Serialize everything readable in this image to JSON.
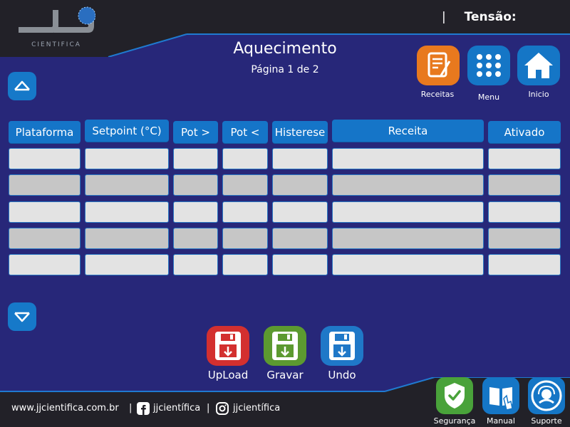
{
  "header": {
    "brand_text": "CIENTIFICA",
    "tensao_label": "Tensão:",
    "separator": "|"
  },
  "page": {
    "title": "Aquecimento",
    "subtitle": "Página 1 de 2"
  },
  "nav_tiles": {
    "receitas": "Receitas",
    "menu": "Menu",
    "inicio": "Inicio"
  },
  "table": {
    "columns": [
      "Plataforma",
      "Setpoint (°C)",
      "Pot >",
      "Pot <",
      "Histerese",
      "Receita",
      "Ativado"
    ],
    "rows": [
      [
        "",
        "",
        "",
        "",
        "",
        "",
        ""
      ],
      [
        "",
        "",
        "",
        "",
        "",
        "",
        ""
      ],
      [
        "",
        "",
        "",
        "",
        "",
        "",
        ""
      ],
      [
        "",
        "",
        "",
        "",
        "",
        "",
        ""
      ],
      [
        "",
        "",
        "",
        "",
        "",
        "",
        ""
      ]
    ]
  },
  "actions": {
    "upload": "UpLoad",
    "gravar": "Gravar",
    "undo": "Undo"
  },
  "footer": {
    "website": "www.jjcientifica.com.br",
    "sep1": "|",
    "facebook": "jjcientífica",
    "sep2": "|",
    "instagram": "jjcientífica",
    "seguranca": "Segurança",
    "manual": "Manual",
    "suporte": "Suporte"
  },
  "colors": {
    "background": "#272779",
    "band": "#222128",
    "table_header": "#1575c8",
    "receitas_tile": "#e8791e",
    "menu_tile": "#1576c6",
    "upload": "#d3302f",
    "gravar": "#5c9a30",
    "undo": "#1f78c8",
    "seguranca": "#49a23a"
  }
}
